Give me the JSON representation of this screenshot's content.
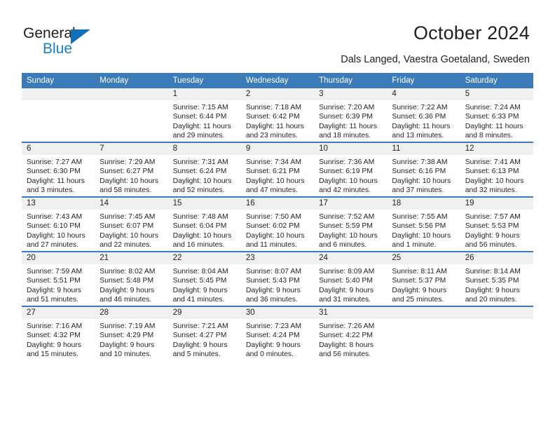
{
  "brand": {
    "name_top": "General",
    "name_bottom": "Blue",
    "accent_color": "#1b7fc4",
    "triangle_color": "#1371b8"
  },
  "header": {
    "title": "October 2024",
    "subtitle": "Dals Langed, Vaestra Goetaland, Sweden"
  },
  "calendar": {
    "header_bg": "#3b7cb8",
    "daynum_bg": "#f0f0f0",
    "weekday_headers": [
      "Sunday",
      "Monday",
      "Tuesday",
      "Wednesday",
      "Thursday",
      "Friday",
      "Saturday"
    ],
    "weeks": [
      [
        {
          "day": "",
          "sunrise": "",
          "sunset": "",
          "daylight_line1": "",
          "daylight_line2": ""
        },
        {
          "day": "",
          "sunrise": "",
          "sunset": "",
          "daylight_line1": "",
          "daylight_line2": ""
        },
        {
          "day": "1",
          "sunrise": "Sunrise: 7:15 AM",
          "sunset": "Sunset: 6:44 PM",
          "daylight_line1": "Daylight: 11 hours",
          "daylight_line2": "and 29 minutes."
        },
        {
          "day": "2",
          "sunrise": "Sunrise: 7:18 AM",
          "sunset": "Sunset: 6:42 PM",
          "daylight_line1": "Daylight: 11 hours",
          "daylight_line2": "and 23 minutes."
        },
        {
          "day": "3",
          "sunrise": "Sunrise: 7:20 AM",
          "sunset": "Sunset: 6:39 PM",
          "daylight_line1": "Daylight: 11 hours",
          "daylight_line2": "and 18 minutes."
        },
        {
          "day": "4",
          "sunrise": "Sunrise: 7:22 AM",
          "sunset": "Sunset: 6:36 PM",
          "daylight_line1": "Daylight: 11 hours",
          "daylight_line2": "and 13 minutes."
        },
        {
          "day": "5",
          "sunrise": "Sunrise: 7:24 AM",
          "sunset": "Sunset: 6:33 PM",
          "daylight_line1": "Daylight: 11 hours",
          "daylight_line2": "and 8 minutes."
        }
      ],
      [
        {
          "day": "6",
          "sunrise": "Sunrise: 7:27 AM",
          "sunset": "Sunset: 6:30 PM",
          "daylight_line1": "Daylight: 11 hours",
          "daylight_line2": "and 3 minutes."
        },
        {
          "day": "7",
          "sunrise": "Sunrise: 7:29 AM",
          "sunset": "Sunset: 6:27 PM",
          "daylight_line1": "Daylight: 10 hours",
          "daylight_line2": "and 58 minutes."
        },
        {
          "day": "8",
          "sunrise": "Sunrise: 7:31 AM",
          "sunset": "Sunset: 6:24 PM",
          "daylight_line1": "Daylight: 10 hours",
          "daylight_line2": "and 52 minutes."
        },
        {
          "day": "9",
          "sunrise": "Sunrise: 7:34 AM",
          "sunset": "Sunset: 6:21 PM",
          "daylight_line1": "Daylight: 10 hours",
          "daylight_line2": "and 47 minutes."
        },
        {
          "day": "10",
          "sunrise": "Sunrise: 7:36 AM",
          "sunset": "Sunset: 6:19 PM",
          "daylight_line1": "Daylight: 10 hours",
          "daylight_line2": "and 42 minutes."
        },
        {
          "day": "11",
          "sunrise": "Sunrise: 7:38 AM",
          "sunset": "Sunset: 6:16 PM",
          "daylight_line1": "Daylight: 10 hours",
          "daylight_line2": "and 37 minutes."
        },
        {
          "day": "12",
          "sunrise": "Sunrise: 7:41 AM",
          "sunset": "Sunset: 6:13 PM",
          "daylight_line1": "Daylight: 10 hours",
          "daylight_line2": "and 32 minutes."
        }
      ],
      [
        {
          "day": "13",
          "sunrise": "Sunrise: 7:43 AM",
          "sunset": "Sunset: 6:10 PM",
          "daylight_line1": "Daylight: 10 hours",
          "daylight_line2": "and 27 minutes."
        },
        {
          "day": "14",
          "sunrise": "Sunrise: 7:45 AM",
          "sunset": "Sunset: 6:07 PM",
          "daylight_line1": "Daylight: 10 hours",
          "daylight_line2": "and 22 minutes."
        },
        {
          "day": "15",
          "sunrise": "Sunrise: 7:48 AM",
          "sunset": "Sunset: 6:04 PM",
          "daylight_line1": "Daylight: 10 hours",
          "daylight_line2": "and 16 minutes."
        },
        {
          "day": "16",
          "sunrise": "Sunrise: 7:50 AM",
          "sunset": "Sunset: 6:02 PM",
          "daylight_line1": "Daylight: 10 hours",
          "daylight_line2": "and 11 minutes."
        },
        {
          "day": "17",
          "sunrise": "Sunrise: 7:52 AM",
          "sunset": "Sunset: 5:59 PM",
          "daylight_line1": "Daylight: 10 hours",
          "daylight_line2": "and 6 minutes."
        },
        {
          "day": "18",
          "sunrise": "Sunrise: 7:55 AM",
          "sunset": "Sunset: 5:56 PM",
          "daylight_line1": "Daylight: 10 hours",
          "daylight_line2": "and 1 minute."
        },
        {
          "day": "19",
          "sunrise": "Sunrise: 7:57 AM",
          "sunset": "Sunset: 5:53 PM",
          "daylight_line1": "Daylight: 9 hours",
          "daylight_line2": "and 56 minutes."
        }
      ],
      [
        {
          "day": "20",
          "sunrise": "Sunrise: 7:59 AM",
          "sunset": "Sunset: 5:51 PM",
          "daylight_line1": "Daylight: 9 hours",
          "daylight_line2": "and 51 minutes."
        },
        {
          "day": "21",
          "sunrise": "Sunrise: 8:02 AM",
          "sunset": "Sunset: 5:48 PM",
          "daylight_line1": "Daylight: 9 hours",
          "daylight_line2": "and 46 minutes."
        },
        {
          "day": "22",
          "sunrise": "Sunrise: 8:04 AM",
          "sunset": "Sunset: 5:45 PM",
          "daylight_line1": "Daylight: 9 hours",
          "daylight_line2": "and 41 minutes."
        },
        {
          "day": "23",
          "sunrise": "Sunrise: 8:07 AM",
          "sunset": "Sunset: 5:43 PM",
          "daylight_line1": "Daylight: 9 hours",
          "daylight_line2": "and 36 minutes."
        },
        {
          "day": "24",
          "sunrise": "Sunrise: 8:09 AM",
          "sunset": "Sunset: 5:40 PM",
          "daylight_line1": "Daylight: 9 hours",
          "daylight_line2": "and 31 minutes."
        },
        {
          "day": "25",
          "sunrise": "Sunrise: 8:11 AM",
          "sunset": "Sunset: 5:37 PM",
          "daylight_line1": "Daylight: 9 hours",
          "daylight_line2": "and 25 minutes."
        },
        {
          "day": "26",
          "sunrise": "Sunrise: 8:14 AM",
          "sunset": "Sunset: 5:35 PM",
          "daylight_line1": "Daylight: 9 hours",
          "daylight_line2": "and 20 minutes."
        }
      ],
      [
        {
          "day": "27",
          "sunrise": "Sunrise: 7:16 AM",
          "sunset": "Sunset: 4:32 PM",
          "daylight_line1": "Daylight: 9 hours",
          "daylight_line2": "and 15 minutes."
        },
        {
          "day": "28",
          "sunrise": "Sunrise: 7:19 AM",
          "sunset": "Sunset: 4:29 PM",
          "daylight_line1": "Daylight: 9 hours",
          "daylight_line2": "and 10 minutes."
        },
        {
          "day": "29",
          "sunrise": "Sunrise: 7:21 AM",
          "sunset": "Sunset: 4:27 PM",
          "daylight_line1": "Daylight: 9 hours",
          "daylight_line2": "and 5 minutes."
        },
        {
          "day": "30",
          "sunrise": "Sunrise: 7:23 AM",
          "sunset": "Sunset: 4:24 PM",
          "daylight_line1": "Daylight: 9 hours",
          "daylight_line2": "and 0 minutes."
        },
        {
          "day": "31",
          "sunrise": "Sunrise: 7:26 AM",
          "sunset": "Sunset: 4:22 PM",
          "daylight_line1": "Daylight: 8 hours",
          "daylight_line2": "and 56 minutes."
        },
        {
          "day": "",
          "sunrise": "",
          "sunset": "",
          "daylight_line1": "",
          "daylight_line2": ""
        },
        {
          "day": "",
          "sunrise": "",
          "sunset": "",
          "daylight_line1": "",
          "daylight_line2": ""
        }
      ]
    ]
  }
}
